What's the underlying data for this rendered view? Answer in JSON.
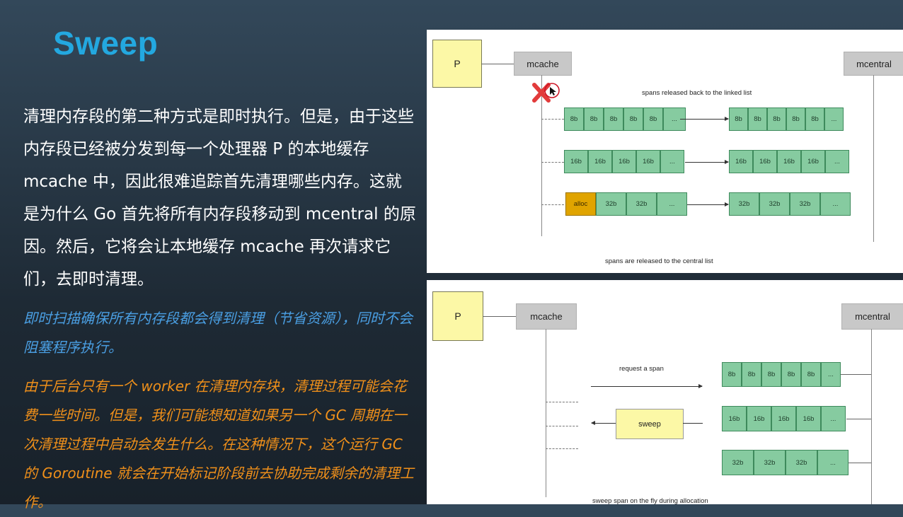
{
  "slide": {
    "title": "Sweep",
    "paragraph": "清理内存段的第二种方式是即时执行。但是，由于这些内存段已经被分发到每一个处理器 P 的本地缓存 mcache 中，因此很难追踪首先清理哪些内存。这就是为什么 Go 首先将所有内存段移动到 mcentral 的原因。然后，它将会让本地缓存 mcache 再次请求它们，去即时清理。",
    "note_blue": "即时扫描确保所有内存段都会得到清理（节省资源），同时不会阻塞程序执行。",
    "note_orange": "由于后台只有一个 worker 在清理内存块，清理过程可能会花费一些时间。但是，我们可能想知道如果另一个 GC 周期在一次清理过程中启动会发生什么。在这种情况下，这个运行 GC 的 Goroutine 就会在开始标记阶段前去协助完成剩余的清理工作。"
  },
  "diagram_top": {
    "p_label": "P",
    "mcache_label": "mcache",
    "mcentral_label": "mcentral",
    "top_caption": "spans released back to the linked list",
    "bottom_caption": "spans are released to the central list",
    "left_rows": [
      [
        "8b",
        "8b",
        "8b",
        "8b",
        "8b",
        "..."
      ],
      [
        "16b",
        "16b",
        "16b",
        "16b",
        "..."
      ],
      [
        "alloc",
        "32b",
        "32b",
        "..."
      ]
    ],
    "right_rows": [
      [
        "8b",
        "8b",
        "8b",
        "8b",
        "8b",
        "..."
      ],
      [
        "16b",
        "16b",
        "16b",
        "16b",
        "..."
      ],
      [
        "32b",
        "32b",
        "32b",
        "..."
      ]
    ]
  },
  "diagram_bottom": {
    "p_label": "P",
    "mcache_label": "mcache",
    "mcentral_label": "mcentral",
    "request_label": "request a span",
    "sweep_label": "sweep",
    "bottom_caption": "sweep span on the fly during allocation",
    "rows": [
      [
        "8b",
        "8b",
        "8b",
        "8b",
        "8b",
        "..."
      ],
      [
        "16b",
        "16b",
        "16b",
        "16b",
        "..."
      ],
      [
        "32b",
        "32b",
        "32b",
        "..."
      ]
    ]
  },
  "colors": {
    "title": "#23a8e0",
    "blue_note": "#4a9fe3",
    "orange_note": "#f0901a",
    "span_cell": "#86cba0",
    "alloc_cell": "#e0a400",
    "p_box": "#fcf8a6",
    "remove_mark": "#e23b3b"
  },
  "icons": [
    "remove-x-icon",
    "cursor-icon"
  ]
}
